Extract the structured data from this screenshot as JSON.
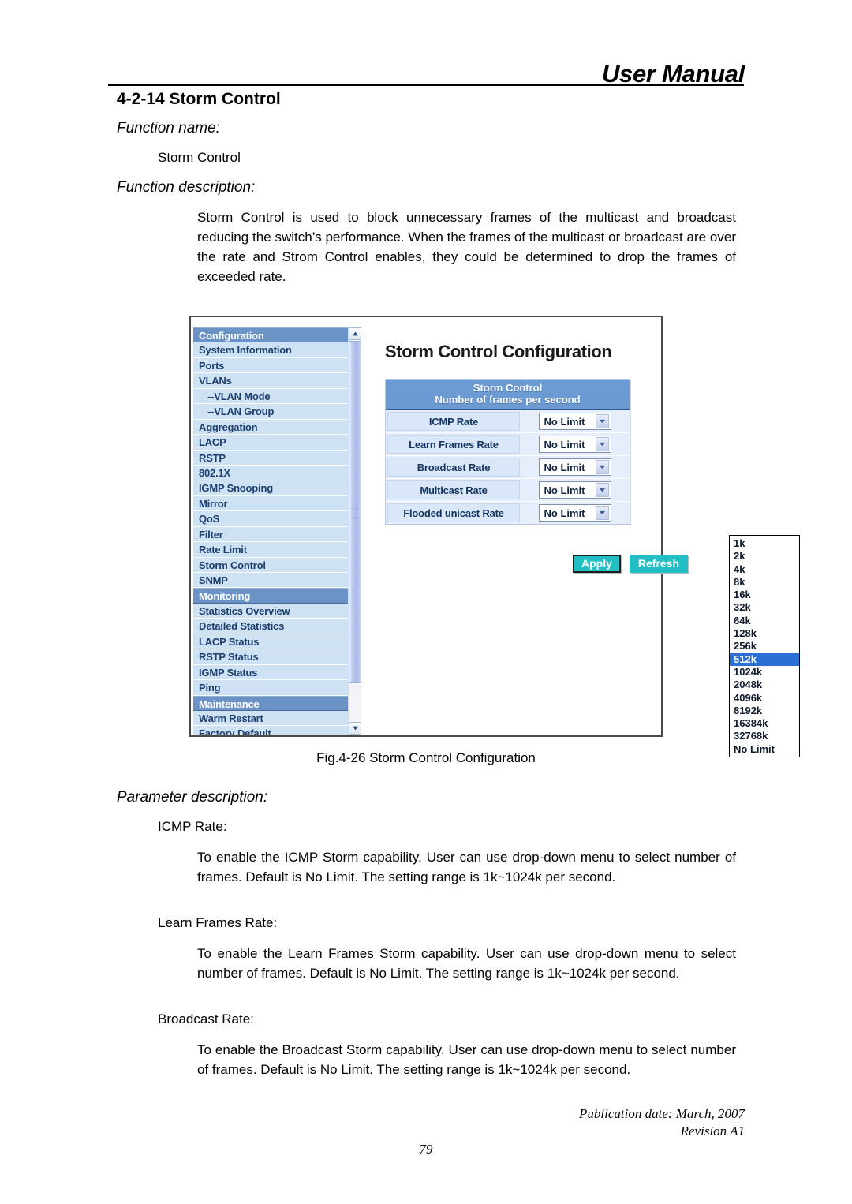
{
  "header": {
    "manual_title": "User Manual"
  },
  "section": {
    "heading": "4-2-14 Storm Control",
    "function_name_label": "Function name:",
    "function_name_value": "Storm Control",
    "function_description_label": "Function description:",
    "function_description_text": "Storm Control is used to block unnecessary frames of the multicast and broadcast reducing the switch’s performance. When the frames of the multicast or broadcast are over the rate and Strom Control enables, they could be determined to drop the frames of exceeded rate.",
    "parameter_description_label": "Parameter description:"
  },
  "figure": {
    "caption": "Fig.4-26 Storm Control Configuration",
    "sidebar": {
      "items": [
        {
          "label": "Configuration",
          "type": "section"
        },
        {
          "label": "System Information",
          "type": "item"
        },
        {
          "label": "Ports",
          "type": "item"
        },
        {
          "label": "VLANs",
          "type": "item"
        },
        {
          "label": "--VLAN Mode",
          "type": "sub"
        },
        {
          "label": "--VLAN Group",
          "type": "sub"
        },
        {
          "label": "Aggregation",
          "type": "item"
        },
        {
          "label": "LACP",
          "type": "item"
        },
        {
          "label": "RSTP",
          "type": "item"
        },
        {
          "label": "802.1X",
          "type": "item"
        },
        {
          "label": "IGMP Snooping",
          "type": "item"
        },
        {
          "label": "Mirror",
          "type": "item"
        },
        {
          "label": "QoS",
          "type": "item"
        },
        {
          "label": "Filter",
          "type": "item"
        },
        {
          "label": "Rate Limit",
          "type": "item"
        },
        {
          "label": "Storm Control",
          "type": "item"
        },
        {
          "label": "SNMP",
          "type": "item"
        },
        {
          "label": "Monitoring",
          "type": "section"
        },
        {
          "label": "Statistics Overview",
          "type": "item"
        },
        {
          "label": "Detailed Statistics",
          "type": "item"
        },
        {
          "label": "LACP Status",
          "type": "item"
        },
        {
          "label": "RSTP Status",
          "type": "item"
        },
        {
          "label": "IGMP Status",
          "type": "item"
        },
        {
          "label": "Ping",
          "type": "item"
        },
        {
          "label": "Maintenance",
          "type": "section"
        },
        {
          "label": "Warm Restart",
          "type": "item"
        },
        {
          "label": "Factory Default",
          "type": "item"
        }
      ]
    },
    "panel": {
      "title": "Storm Control Configuration",
      "table_header_line1": "Storm Control",
      "table_header_line2": "Number of frames per second",
      "rows": [
        {
          "label": "ICMP Rate",
          "value": "No Limit"
        },
        {
          "label": "Learn Frames Rate",
          "value": "No Limit"
        },
        {
          "label": "Broadcast Rate",
          "value": "No Limit"
        },
        {
          "label": "Multicast Rate",
          "value": "No Limit"
        },
        {
          "label": "Flooded unicast Rate",
          "value": "No Limit"
        }
      ],
      "dropdown": {
        "open_for": "Flooded unicast Rate",
        "selected": "512k",
        "options": [
          "1k",
          "2k",
          "4k",
          "8k",
          "16k",
          "32k",
          "64k",
          "128k",
          "256k",
          "512k",
          "1024k",
          "2048k",
          "4096k",
          "8192k",
          "16384k",
          "32768k",
          "No Limit"
        ]
      },
      "buttons": {
        "apply": "Apply",
        "refresh": "Refresh"
      }
    }
  },
  "parameters": [
    {
      "name": "ICMP Rate:",
      "text": "To enable the ICMP Storm capability. User can use drop-down menu to select number of frames. Default is No Limit. The setting range is 1k~1024k per second."
    },
    {
      "name": "Learn Frames Rate:",
      "text": "To enable the Learn Frames Storm capability. User can use drop-down menu to select number of frames. Default is No Limit. The setting range is 1k~1024k per second."
    },
    {
      "name": "Broadcast Rate:",
      "text": "To enable the Broadcast Storm capability. User can use drop-down menu to select number of frames. Default is No Limit. The setting range is 1k~1024k per second."
    }
  ],
  "footer": {
    "publication_date": "Publication date: March, 2007",
    "revision": "Revision A1",
    "page_number": "79"
  },
  "colors": {
    "menu_section_bg": "#6b93c6",
    "menu_item_bg": "#cfe2f3",
    "table_header_bg": "#6b9bd2",
    "button_bg": "#21bfc4",
    "dropdown_selected_bg": "#2b6fd4"
  }
}
